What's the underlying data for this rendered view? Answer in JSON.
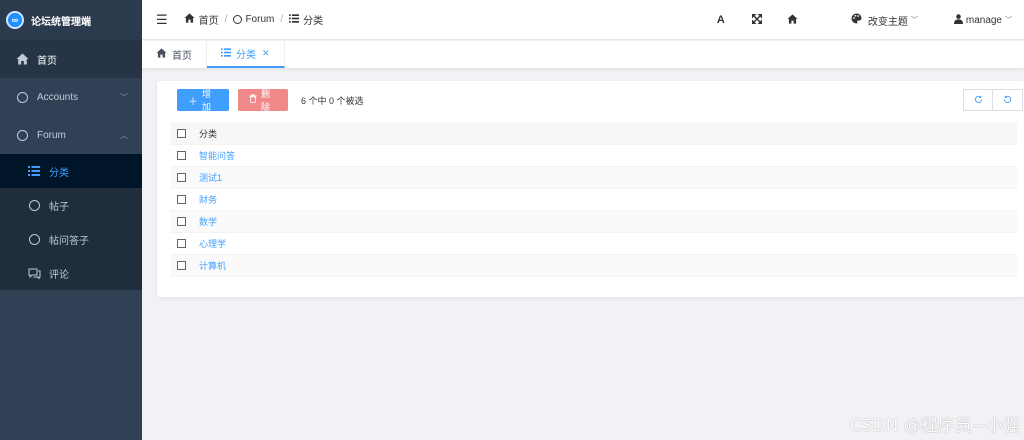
{
  "app": {
    "title": "论坛统管理端",
    "logo_glyph": "∞"
  },
  "sidebar": {
    "home": {
      "label": "首页",
      "icon": "home-icon"
    },
    "accounts": {
      "label": "Accounts",
      "icon": "circle-icon"
    },
    "forum": {
      "label": "Forum",
      "icon": "circle-icon"
    },
    "forum_items": [
      {
        "label": "分类",
        "icon": "list-icon"
      },
      {
        "label": "帖子",
        "icon": "circle-icon"
      },
      {
        "label": "帖问答子",
        "icon": "circle-icon"
      },
      {
        "label": "评论",
        "icon": "comment-icon"
      }
    ]
  },
  "navbar": {
    "breadcrumb": [
      "首页",
      "Forum",
      "分类"
    ],
    "font_size_icon": "A",
    "theme_label": "改变主题",
    "user_name": "manage"
  },
  "tags": [
    {
      "label": "首页",
      "active": false
    },
    {
      "label": "分类",
      "active": true
    }
  ],
  "toolbar": {
    "add_label": "增加",
    "delete_label": "删除",
    "selection_info": "6 个中 0 个被选"
  },
  "table": {
    "header": "分类",
    "rows": [
      "智能问答",
      "测试1",
      "财务",
      "数学",
      "心理学",
      "计算机"
    ]
  },
  "watermark": "CSDN @程序员~小强",
  "colors": {
    "accent": "#409eff",
    "sidebar_bg": "#304156",
    "danger": "#f08a8a"
  }
}
